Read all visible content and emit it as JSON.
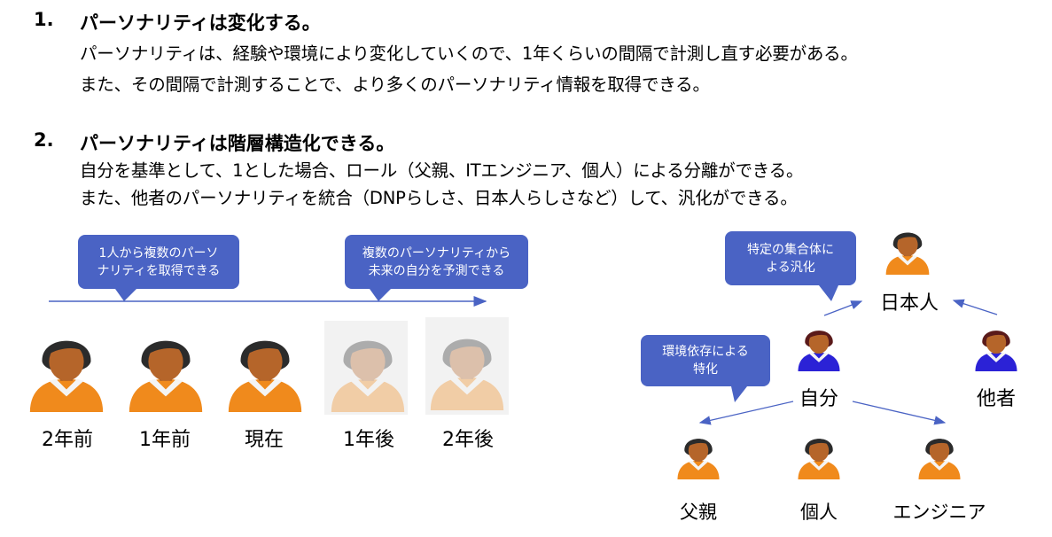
{
  "section1": {
    "num": "1.",
    "heading": "パーソナリティは変化する。",
    "lines": [
      "パーソナリティは、経験や環境により変化していくので、1年くらいの間隔で計測し直す必要がある。",
      "また、その間隔で計測することで、より多くのパーソナリティ情報を取得できる。"
    ]
  },
  "section2": {
    "num": "2.",
    "heading": "パーソナリティは階層構造化できる。",
    "lines": [
      "自分を基準として、1とした場合、ロール（父親、ITエンジニア、個人）による分離ができる。",
      "また、他者のパーソナリティを統合（DNPらしさ、日本人らしさなど）して、汎化ができる。"
    ]
  },
  "timeline": {
    "callout_left": [
      "1人から複数のパーソ",
      "ナリティを取得できる"
    ],
    "callout_right": [
      "複数のパーソナリティから",
      "未来の自分を予測できる"
    ],
    "labels": [
      "2年前",
      "1年前",
      "現在",
      "1年後",
      "2年後"
    ]
  },
  "hierarchy": {
    "callout_top": [
      "特定の集合体に",
      "よる汎化"
    ],
    "callout_left": [
      "環境依存による",
      "特化"
    ],
    "japanese": "日本人",
    "self": "自分",
    "other": "他者",
    "father": "父親",
    "individual": "個人",
    "engineer": "エンジニア"
  },
  "colors": {
    "callout": "#4a63c4",
    "arrow": "#4a63c4",
    "orange_body": "#f08a1c",
    "blue_body": "#2b22d6"
  }
}
